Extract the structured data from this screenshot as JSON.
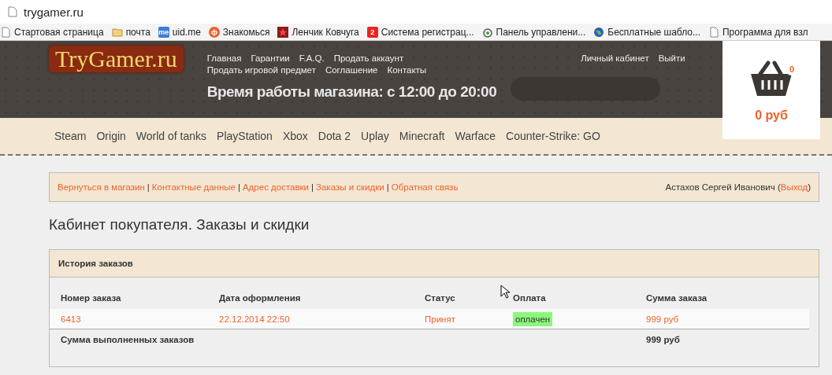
{
  "browser": {
    "address": "trygamer.ru",
    "bookmarks": [
      {
        "kind": "page",
        "label": "Стартовая страница"
      },
      {
        "kind": "folder",
        "label": "почта"
      },
      {
        "kind": "badge",
        "badge": "me",
        "label": "uid.me"
      },
      {
        "kind": "round",
        "badge": "ф",
        "label": "Знакомься"
      },
      {
        "kind": "star",
        "label": "Ленчик Ковчуга"
      },
      {
        "kind": "badge-red",
        "badge": "2",
        "label": "Система регистрац..."
      },
      {
        "kind": "eye",
        "label": "Панель управлени..."
      },
      {
        "kind": "globe",
        "label": "Бесплатные шабло..."
      },
      {
        "kind": "page",
        "label": "Программа для взл"
      }
    ]
  },
  "header": {
    "logo": "TryGamer.ru",
    "links": [
      "Главная",
      "Гарантии",
      "F.A.Q.",
      "Продать аккаунт",
      "Продать игровой предмет",
      "Соглашение",
      "Контакты"
    ],
    "hours": "Время работы магазина: с 12:00 до 20:00",
    "account_links": [
      "Личный кабинет",
      "Выйти"
    ],
    "cart": {
      "count": "0",
      "total": "0 руб"
    }
  },
  "categories": [
    "Steam",
    "Origin",
    "World of tanks",
    "PlayStation",
    "Xbox",
    "Dota 2",
    "Uplay",
    "Minecraft",
    "Warface",
    "Counter-Strike: GO"
  ],
  "account_nav": {
    "links": [
      "Вернуться в магазин",
      "Контактные данные",
      "Адрес доставки",
      "Заказы и скидки",
      "Обратная связь"
    ],
    "separator": "|",
    "user": "Астахов Сергей Иванович (",
    "logout": "Выход",
    "close": ")"
  },
  "page_title": "Кабинет покупателя. Заказы и скидки",
  "orders": {
    "title": "История заказов",
    "columns": [
      "Номер заказа",
      "Дата оформления",
      "Статус",
      "Оплата",
      "Сумма заказа"
    ],
    "rows": [
      {
        "number": "6413",
        "date": "22.12.2014 22:50",
        "status": "Принят",
        "payment": "оплачен",
        "paid": true,
        "sum": "999 руб"
      }
    ],
    "total_label": "Сумма выполненных заказов",
    "total": "999 руб"
  }
}
